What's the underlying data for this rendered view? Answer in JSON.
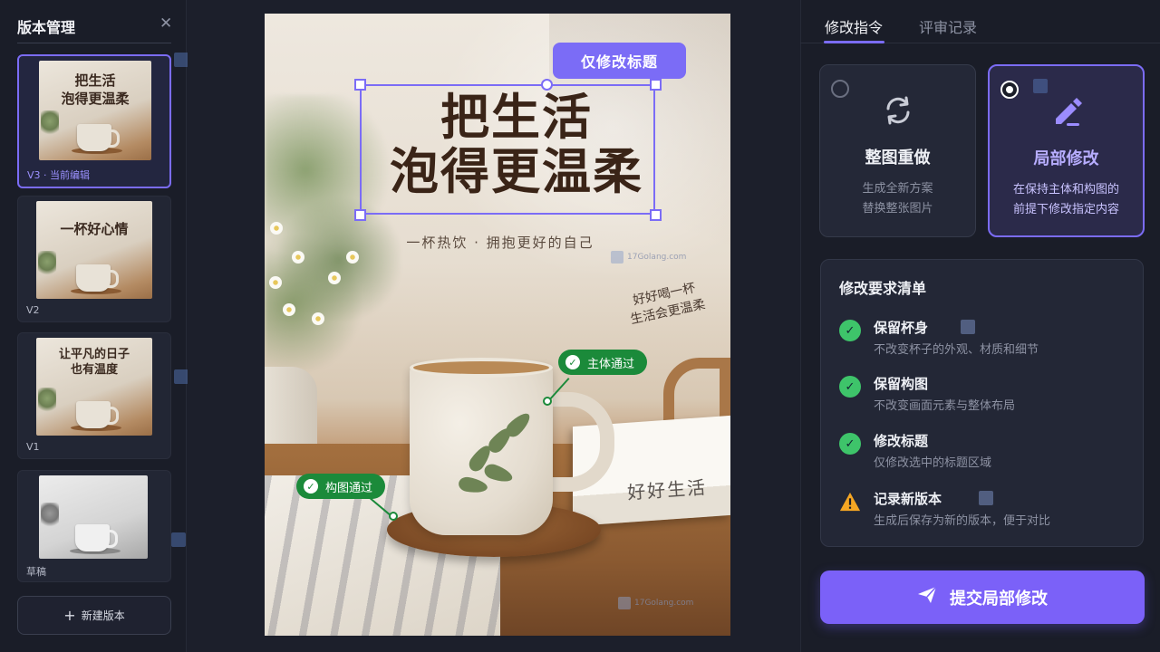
{
  "sidebar": {
    "title": "版本管理",
    "versions": [
      {
        "label": "V3 · 当前编辑",
        "thumb_text": "把生活\n泡得更温柔",
        "active": true
      },
      {
        "label": "V2",
        "thumb_text": "一杯好心情",
        "active": false
      },
      {
        "label": "V1",
        "thumb_text": "让平凡的日子\n也有温度",
        "active": false
      },
      {
        "label": "草稿",
        "thumb_text": "",
        "active": false
      }
    ],
    "new_version_label": "新建版本"
  },
  "canvas": {
    "headline": "把生活\n泡得更温柔",
    "subline": "一杯热饮 · 拥抱更好的自己",
    "handwriting": "好好喝一杯\n生活会更温柔",
    "book_text": "好好生活",
    "selection_tag": "仅修改标题",
    "watermark": "17Golang.com",
    "pass_tags": {
      "subject": "主体通过",
      "composition": "构图通过"
    }
  },
  "right_panel": {
    "tabs": [
      {
        "label": "修改指令",
        "active": true
      },
      {
        "label": "评审记录",
        "active": false
      }
    ],
    "modes": [
      {
        "title": "整图重做",
        "desc": "生成全新方案\n替换整张图片",
        "selected": false,
        "icon": "refresh-icon"
      },
      {
        "title": "局部修改",
        "desc": "在保持主体和构图的\n前提下修改指定内容",
        "selected": true,
        "icon": "edit-pen-icon"
      }
    ],
    "checklist": {
      "title": "修改要求清单",
      "items": [
        {
          "name": "保留杯身",
          "desc": "不改变杯子的外观、材质和细节",
          "status": "ok"
        },
        {
          "name": "保留构图",
          "desc": "不改变画面元素与整体布局",
          "status": "ok"
        },
        {
          "name": "修改标题",
          "desc": "仅修改选中的标题区域",
          "status": "ok"
        },
        {
          "name": "记录新版本",
          "desc": "生成后保存为新的版本，便于对比",
          "status": "warn"
        }
      ]
    },
    "submit_label": "提交局部修改"
  },
  "colors": {
    "accent": "#7b6cf6",
    "pass": "#1b8a3a",
    "check": "#3ec46a",
    "warn": "#f5a623"
  }
}
